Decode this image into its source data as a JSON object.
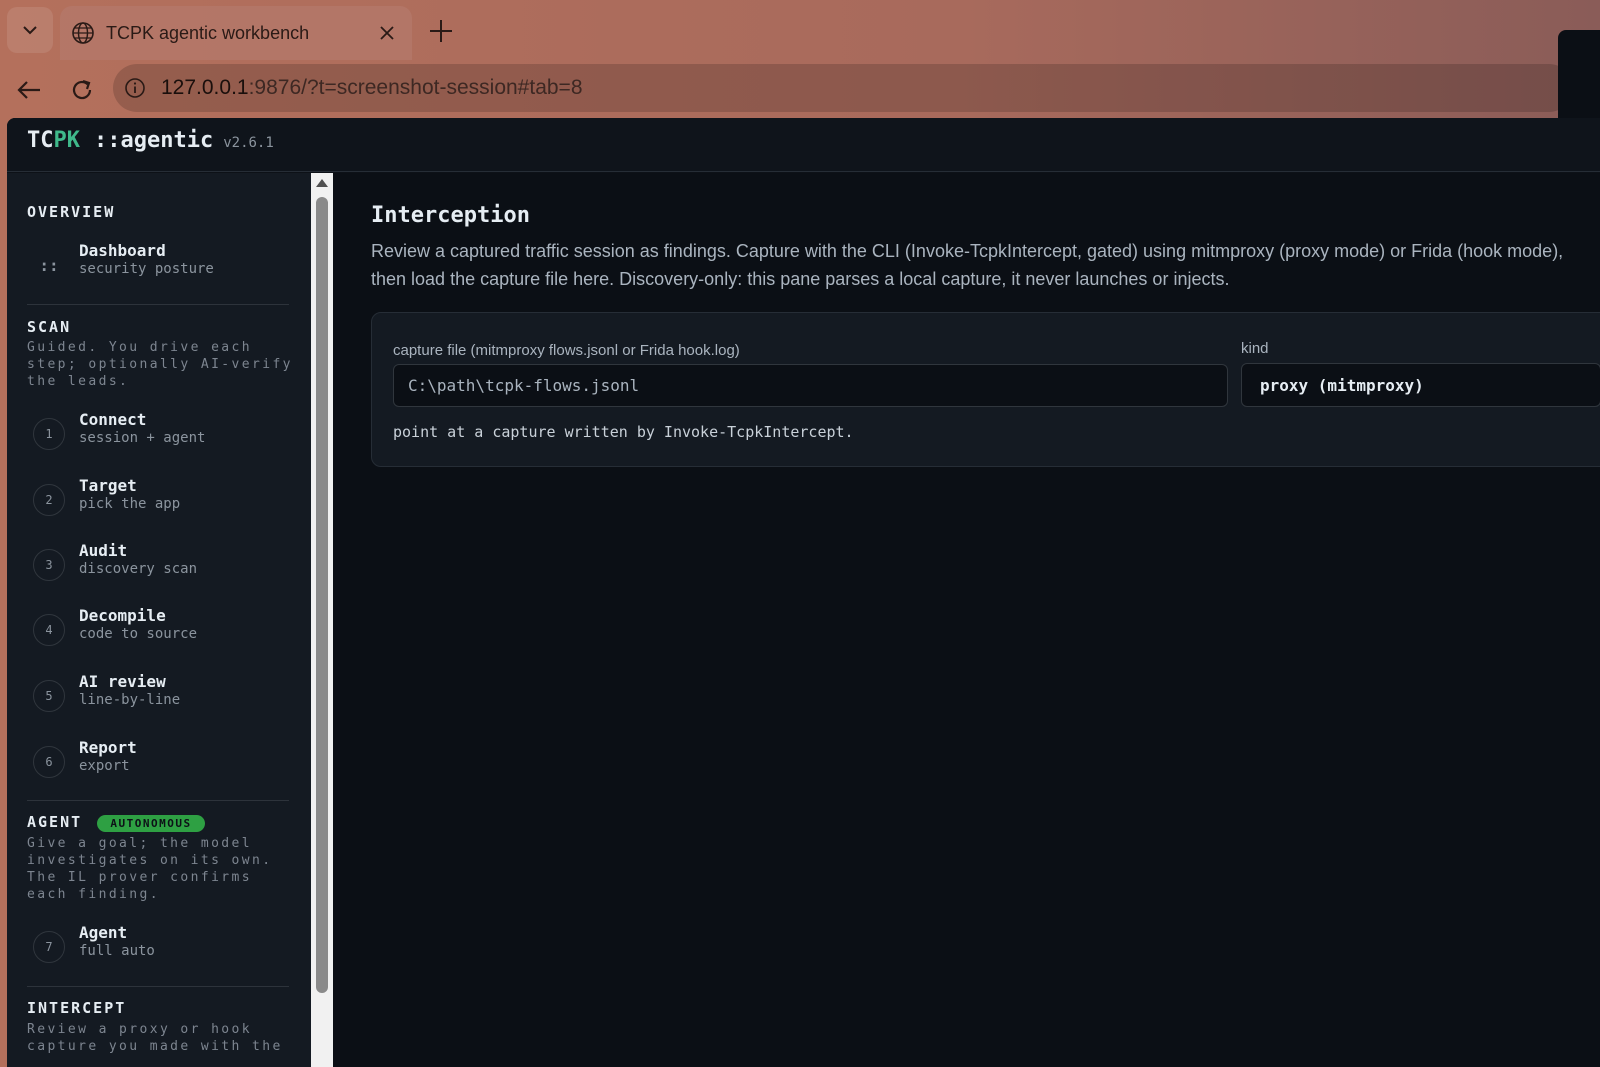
{
  "browser": {
    "tab_title": "TCPK agentic workbench",
    "url_host": "127.0.0.1",
    "url_rest": ":9876/?t=screenshot-session#tab=8"
  },
  "header": {
    "brand_part1": "TC",
    "brand_part2": "PK",
    "brand_part3": "::agentic",
    "version": "v2.6.1"
  },
  "sidebar": {
    "overview": {
      "title": "OVERVIEW",
      "items": [
        {
          "glyph": "::",
          "label": "Dashboard",
          "sub": "security posture"
        }
      ]
    },
    "scan": {
      "title": "SCAN",
      "desc": "Guided. You drive each step; optionally AI-verify the leads.",
      "items": [
        {
          "num": "1",
          "label": "Connect",
          "sub": "session + agent"
        },
        {
          "num": "2",
          "label": "Target",
          "sub": "pick the app"
        },
        {
          "num": "3",
          "label": "Audit",
          "sub": "discovery scan"
        },
        {
          "num": "4",
          "label": "Decompile",
          "sub": "code to source"
        },
        {
          "num": "5",
          "label": "AI review",
          "sub": "line-by-line"
        },
        {
          "num": "6",
          "label": "Report",
          "sub": "export"
        }
      ]
    },
    "agent": {
      "title": "AGENT",
      "badge": "AUTONOMOUS",
      "desc": "Give a goal; the model investigates on its own. The IL prover confirms each finding.",
      "items": [
        {
          "num": "7",
          "label": "Agent",
          "sub": "full auto"
        }
      ]
    },
    "intercept": {
      "title": "INTERCEPT",
      "desc": "Review a proxy or hook capture you made with the"
    }
  },
  "main": {
    "title": "Interception",
    "description": "Review a captured traffic session as findings. Capture with the CLI (Invoke-TcpkIntercept, gated) using mitmproxy (proxy mode) or Frida (hook mode), then load the capture file here. Discovery-only: this pane parses a local capture, it never launches or injects.",
    "capture_label": "capture file (mitmproxy flows.jsonl or Frida hook.log)",
    "capture_placeholder": "C:\\path\\tcpk-flows.jsonl",
    "kind_label": "kind",
    "kind_value": "proxy (mitmproxy)",
    "hint": "point at a capture written by Invoke-TcpkIntercept."
  },
  "colors": {
    "accent_green": "#3fb98b",
    "badge_green": "#2ea043",
    "app_bg": "#0d1117"
  }
}
